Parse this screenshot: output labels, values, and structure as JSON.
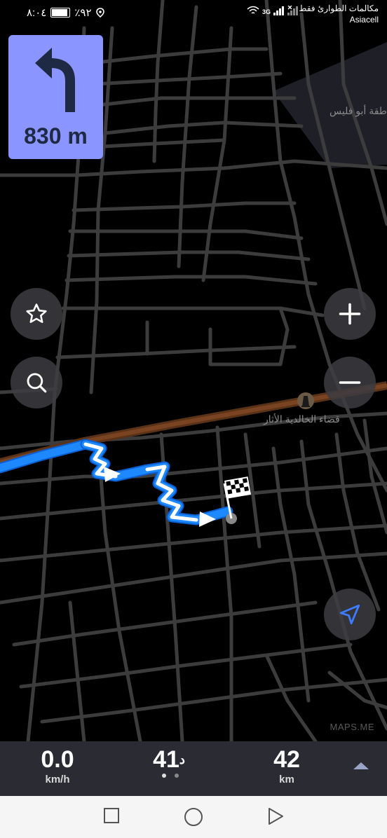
{
  "status_bar": {
    "time": "٨:٠٤",
    "battery": "٪٩٢",
    "carrier_line1": "مكالمات الطوارئ فقط",
    "carrier_line2": "Asiacell",
    "network": "3G"
  },
  "turn_instruction": {
    "direction": "turn-left",
    "distance": "830 m"
  },
  "map": {
    "area_label": "طقة أبو فليس",
    "poi_label": "قضاء الخالدية الأثار",
    "watermark": "MAPS.ME",
    "route_color": "#1e88ff",
    "background_color": "#000000",
    "road_color": "#3c3c3c",
    "highway_color": "#6b3b1c"
  },
  "map_controls": {
    "bookmark": "star-icon",
    "search": "search-icon",
    "zoom_in": "plus-icon",
    "zoom_out": "minus-icon",
    "my_position": "navigation-arrow-icon"
  },
  "bottom_panel": {
    "speed_value": "0.0",
    "speed_unit": "km/h",
    "time_value": "41",
    "time_unit": "د",
    "distance_value": "42",
    "distance_unit": "km",
    "page_dots": 2,
    "active_dot": 0
  },
  "navigation_bar": {
    "recents": "square-icon",
    "home": "circle-icon",
    "back": "triangle-icon"
  }
}
